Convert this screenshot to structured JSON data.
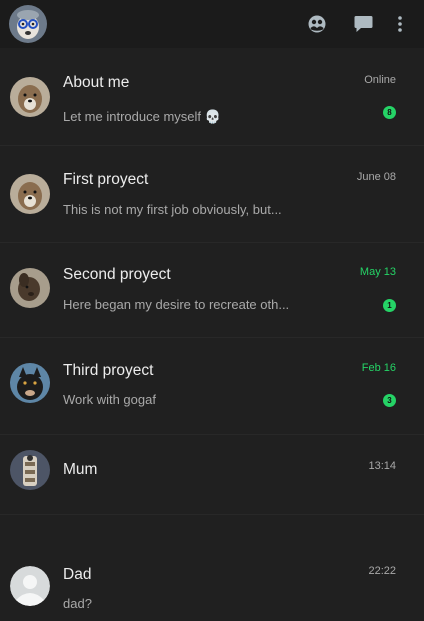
{
  "header": {
    "profile_icon": "user-avatar",
    "actions": [
      "communities-icon",
      "new-chat-icon",
      "menu-icon"
    ]
  },
  "chats": [
    {
      "name": "About me",
      "preview": "Let me introduce myself 💀",
      "time": "Online",
      "badge": "8",
      "time_unread": false,
      "avatar": "dog-avatar-1"
    },
    {
      "name": "First proyect",
      "preview": "This is not my first job obviously, but...",
      "time": "June 08",
      "badge": "",
      "time_unread": false,
      "avatar": "dog-avatar-1"
    },
    {
      "name": "Second proyect",
      "preview": "Here began my desire to recreate oth...",
      "time": "May 13",
      "badge": "1",
      "time_unread": true,
      "avatar": "dog-avatar-2"
    },
    {
      "name": "Third proyect",
      "preview": "Work with gogaf",
      "time": "Feb 16",
      "badge": "3",
      "time_unread": true,
      "avatar": "dog-avatar-3"
    },
    {
      "name": "Mum",
      "preview": "",
      "time": "13:14",
      "badge": "",
      "time_unread": false,
      "avatar": "mum-avatar"
    },
    {
      "name": "Dad",
      "preview": "dad?",
      "time": "22:22",
      "badge": "",
      "time_unread": false,
      "avatar": "default-avatar"
    }
  ],
  "colors": {
    "background": "#202020",
    "topbar": "#1b1b1b",
    "accent": "#25d366"
  }
}
